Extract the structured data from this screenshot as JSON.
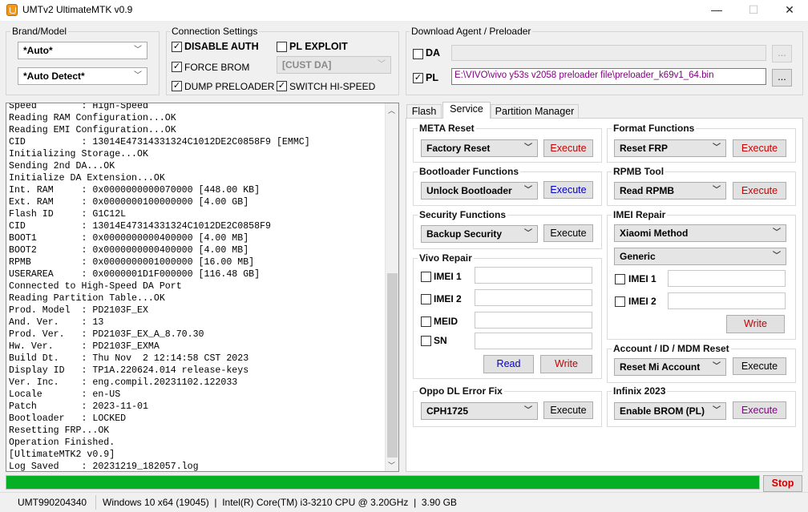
{
  "window": {
    "title": "UMTv2 UltimateMTK v0.9",
    "minimize": "—",
    "maximize": "☐",
    "close": "✕"
  },
  "brand_model": {
    "legend": "Brand/Model",
    "brand_value": "*Auto*",
    "model_value": "*Auto Detect*"
  },
  "connection": {
    "legend": "Connection Settings",
    "disable_auth": {
      "label": "DISABLE AUTH",
      "checked": true
    },
    "pl_exploit": {
      "label": "PL EXPLOIT",
      "checked": false
    },
    "force_brom": {
      "label": "FORCE BROM",
      "checked": true
    },
    "cust_da": "[CUST DA]",
    "dump_preloader": {
      "label": "DUMP PRELOADER",
      "checked": true
    },
    "switch_hispeed": {
      "label": "SWITCH HI-SPEED",
      "checked": true
    }
  },
  "download_agent": {
    "legend": "Download Agent / Preloader",
    "da_label": "DA",
    "da_checked": false,
    "da_path": "",
    "da_browse": "...",
    "pl_label": "PL",
    "pl_checked": true,
    "pl_path": "E:\\VIVO\\vivo y53s v2058 preloader file\\preloader_k69v1_64.bin",
    "pl_browse": "..."
  },
  "log": {
    "lines": [
      "Speed        : High-Speed",
      "Reading RAM Configuration...OK",
      "Reading EMI Configuration...OK",
      "CID          : 13014E47314331324C1012DE2C0858F9 [EMMC]",
      "Initializing Storage...OK",
      "Sending 2nd DA...OK",
      "Initialize DA Extension...OK",
      "Int. RAM     : 0x0000000000070000 [448.00 KB]",
      "Ext. RAM     : 0x0000000100000000 [4.00 GB]",
      "Flash ID     : G1C12L",
      "CID          : 13014E47314331324C1012DE2C0858F9",
      "BOOT1        : 0x0000000000400000 [4.00 MB]",
      "BOOT2        : 0x0000000000400000 [4.00 MB]",
      "RPMB         : 0x0000000001000000 [16.00 MB]",
      "USERAREA     : 0x0000001D1F000000 [116.48 GB]",
      "Connected to High-Speed DA Port",
      "Reading Partition Table...OK",
      "Prod. Model  : PD2103F_EX",
      "And. Ver.    : 13",
      "Prod. Ver.   : PD2103F_EX_A_8.70.30",
      "Hw. Ver.     : PD2103F_EXMA",
      "Build Dt.    : Thu Nov  2 12:14:58 CST 2023",
      "Display ID   : TP1A.220624.014 release-keys",
      "Ver. Inc.    : eng.compil.20231102.122033",
      "Locale       : en-US",
      "Patch        : 2023-11-01",
      "Bootloader   : LOCKED",
      "Resetting FRP...OK",
      "Operation Finished.",
      "[UltimateMTK2 v0.9]",
      "Log Saved    : 20231219_182057.log"
    ]
  },
  "tabs": {
    "flash": "Flash",
    "service": "Service",
    "partition": "Partition Manager"
  },
  "service": {
    "meta_reset": {
      "legend": "META Reset",
      "value": "Factory Reset",
      "button": "Execute"
    },
    "format_functions": {
      "legend": "Format Functions",
      "value": "Reset FRP",
      "button": "Execute"
    },
    "bootloader_functions": {
      "legend": "Bootloader Functions",
      "value": "Unlock Bootloader",
      "button": "Execute"
    },
    "rpmb_tool": {
      "legend": "RPMB Tool",
      "value": "Read RPMB",
      "button": "Execute"
    },
    "security_functions": {
      "legend": "Security Functions",
      "value": "Backup Security",
      "button": "Execute"
    },
    "imei_repair": {
      "legend": "IMEI Repair",
      "method": "Xiaomi Method",
      "type": "Generic",
      "imei1": "IMEI 1",
      "imei2": "IMEI 2",
      "write": "Write"
    },
    "vivo_repair": {
      "legend": "Vivo Repair",
      "imei1": "IMEI 1",
      "imei2": "IMEI 2",
      "meid": "MEID",
      "sn": "SN",
      "read": "Read",
      "write": "Write"
    },
    "account_reset": {
      "legend": "Account / ID / MDM Reset",
      "value": "Reset Mi Account",
      "button": "Execute"
    },
    "oppo_dl": {
      "legend": "Oppo DL Error Fix",
      "value": "CPH1725",
      "button": "Execute"
    },
    "infinix": {
      "legend": "Infinix 2023",
      "value": "Enable BROM (PL)",
      "button": "Execute"
    }
  },
  "progress": {
    "value": 1.0,
    "stop_label": "Stop"
  },
  "status": {
    "id": "UMT990204340",
    "system": "Windows 10 x64 (19045)  |  Intel(R) Core(TM) i3-3210 CPU @ 3.20GHz  |  3.90 GB"
  },
  "colors": {
    "red_text": "#cc0000",
    "blue_text": "#0000cc",
    "purple_text": "#8b008b",
    "progress_green": "#06b025",
    "path_purple": "#800080"
  }
}
